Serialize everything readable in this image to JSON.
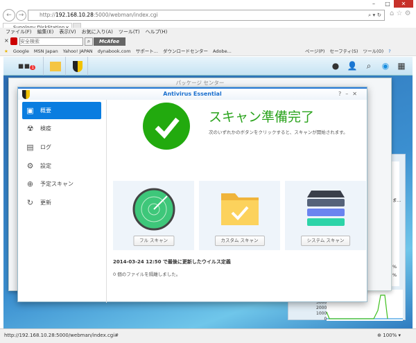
{
  "browser": {
    "url_prefix": "http://",
    "url_host": "192.168.10.28",
    "url_rest": ":5000/webman/index.cgi",
    "tab_title": "Synology DiskStation - ...",
    "menu": [
      "ファイル(F)",
      "編集(E)",
      "表示(V)",
      "お気に入り(A)",
      "ツール(T)",
      "ヘルプ(H)"
    ],
    "search_placeholder": "安全検索",
    "mcafee": "McAfee",
    "favorites": [
      "Google",
      "MSN Japan",
      "Yahoo! JAPAN",
      "dynabook.com",
      "サポート...",
      "ダウンロードセンター",
      "Adobe..."
    ],
    "commands": [
      "ページ(P)",
      "セーフティ(S)",
      "ツール(O)"
    ],
    "status_url": "http://192.168.10.28:5000/webman/index.cgi#",
    "zoom": "100%"
  },
  "dsm": {
    "badge": "1",
    "package_center_title": "パッケージ センター"
  },
  "antivirus": {
    "title": "Antivirus Essential",
    "sidebar": [
      {
        "label": "概要",
        "icon": "overview-icon"
      },
      {
        "label": "検疫",
        "icon": "quarantine-icon"
      },
      {
        "label": "ログ",
        "icon": "log-icon"
      },
      {
        "label": "設定",
        "icon": "gear-icon"
      },
      {
        "label": "予定スキャン",
        "icon": "schedule-icon"
      },
      {
        "label": "更新",
        "icon": "refresh-icon"
      }
    ],
    "status_title": "スキャン準備完了",
    "status_sub": "次のいずれかのボタンをクリックすると、スキャンが開始されます。",
    "scans": [
      "フル スキャン",
      "カスタム スキャン",
      "システム スキャン"
    ],
    "definitions": "2014-03-24 12:50 で最後に更新したウイルス定義",
    "quarantined": "0 個のファイルを隔離しました。",
    "colors": {
      "accent": "#0a7de0",
      "ok": "#22aa0e"
    }
  },
  "widget": {
    "yticks": [
      "3000",
      "2000",
      "1000",
      "0"
    ],
    "pct": [
      "%",
      "%"
    ],
    "more": "ま..."
  }
}
